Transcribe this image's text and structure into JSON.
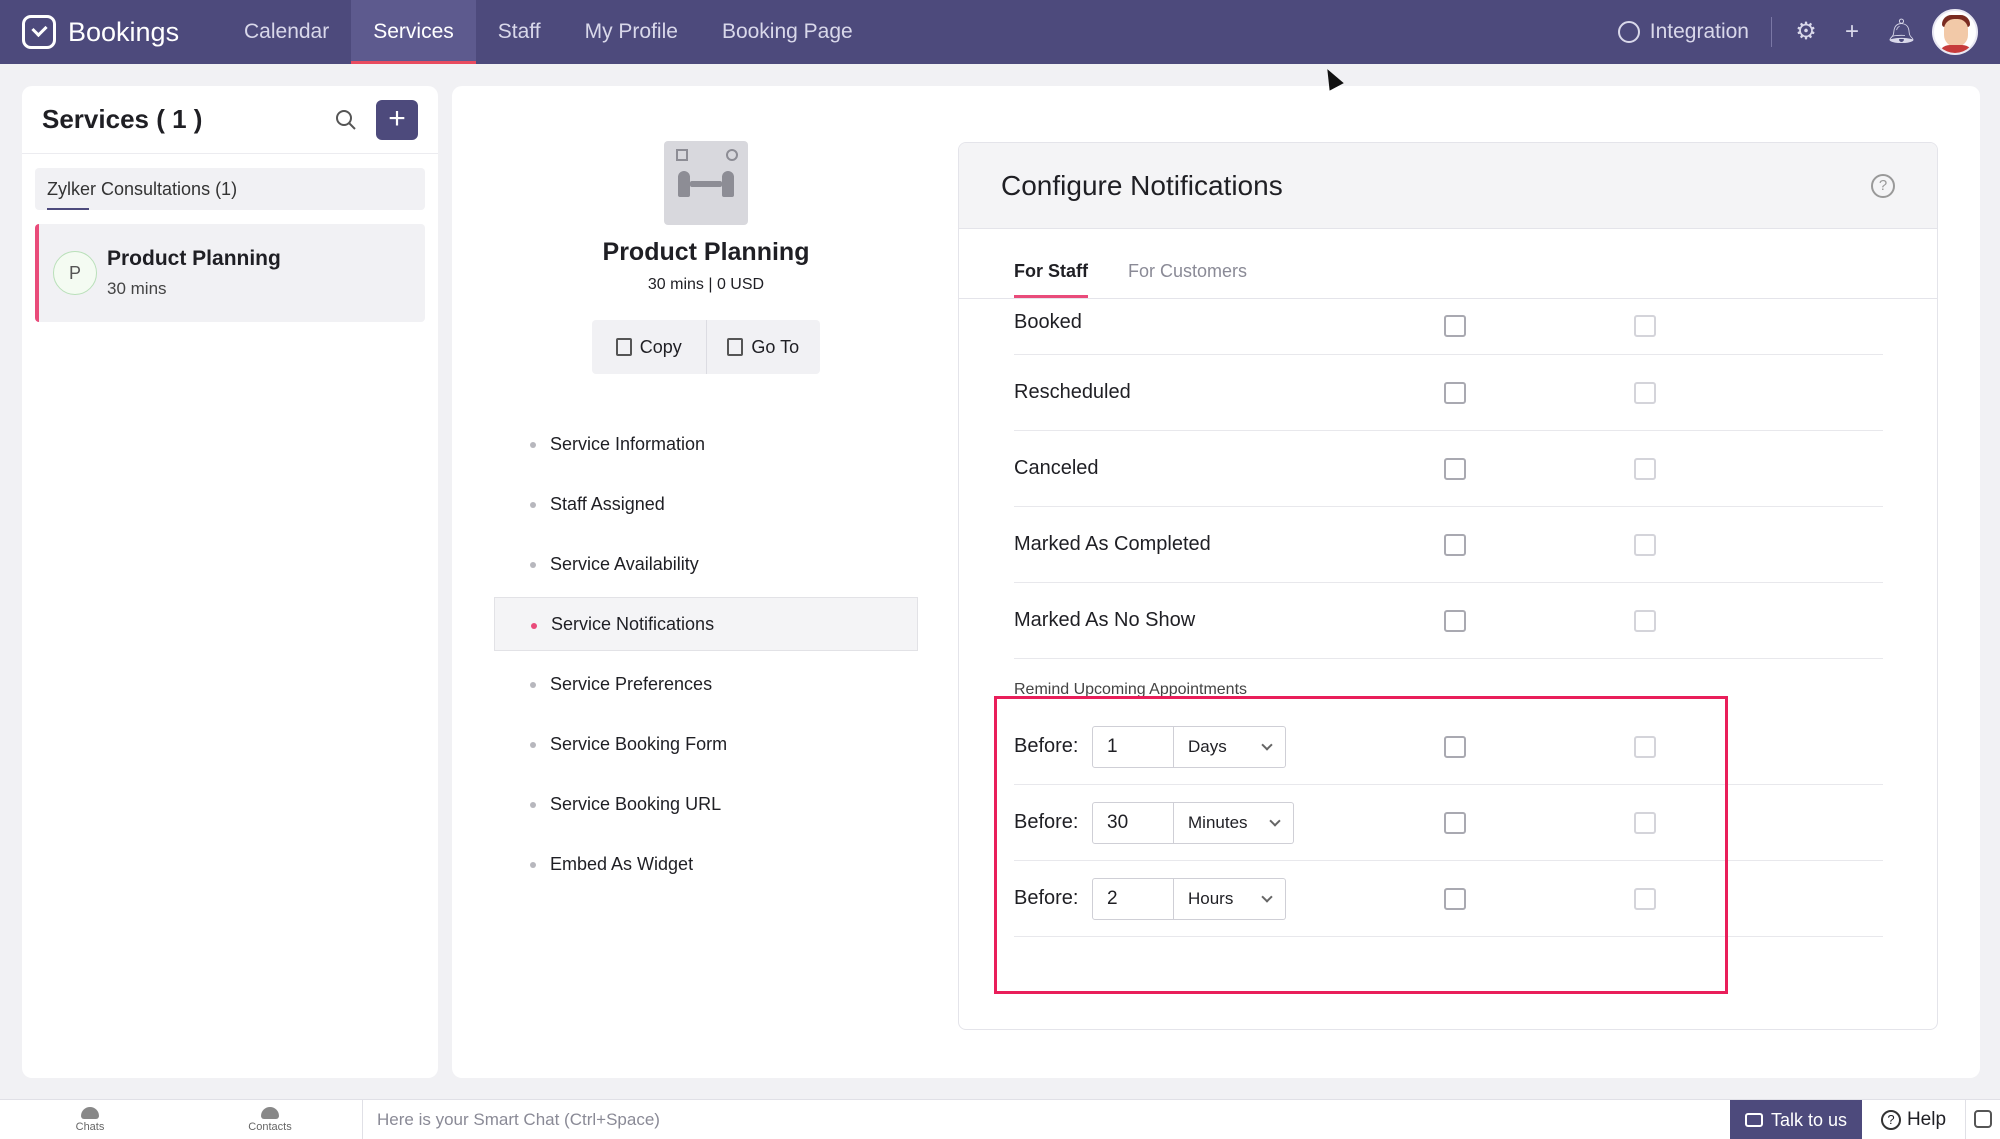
{
  "app": {
    "name": "Bookings"
  },
  "nav": {
    "items": [
      "Calendar",
      "Services",
      "Staff",
      "My Profile",
      "Booking Page"
    ],
    "active": "Services"
  },
  "top_right": {
    "integration_label": "Integration",
    "icons": [
      "settings-icon",
      "plus-icon",
      "bell-icon"
    ]
  },
  "sidebar": {
    "title": "Services ( 1 )",
    "group_label": "Zylker Consultations (1)",
    "service": {
      "initial": "P",
      "name": "Product Planning",
      "duration": "30 mins"
    }
  },
  "service": {
    "name": "Product Planning",
    "meta": "30 mins | 0 USD",
    "copy_label": "Copy",
    "goto_label": "Go To"
  },
  "menu": {
    "items": [
      "Service Information",
      "Staff Assigned",
      "Service Availability",
      "Service Notifications",
      "Service Preferences",
      "Service Booking Form",
      "Service Booking URL",
      "Embed As Widget"
    ],
    "active": "Service Notifications"
  },
  "notifications": {
    "title": "Configure Notifications",
    "tabs": [
      "For Staff",
      "For Customers"
    ],
    "active_tab": "For Staff",
    "events": [
      "Booked",
      "Rescheduled",
      "Canceled",
      "Marked As Completed",
      "Marked As No Show"
    ],
    "remind_title": "Remind Upcoming Appointments",
    "before_label": "Before:",
    "reminders": [
      {
        "value": "1",
        "unit": "Days"
      },
      {
        "value": "30",
        "unit": "Minutes"
      },
      {
        "value": "2",
        "unit": "Hours"
      }
    ]
  },
  "bottom": {
    "chats": "Chats",
    "contacts": "Contacts",
    "smart_chat_placeholder": "Here is your Smart Chat (Ctrl+Space)",
    "talk": "Talk to us",
    "help": "Help"
  },
  "colors": {
    "brand": "#4d4a7c",
    "accent": "#e94b7a",
    "highlight": "#e91e5a"
  }
}
